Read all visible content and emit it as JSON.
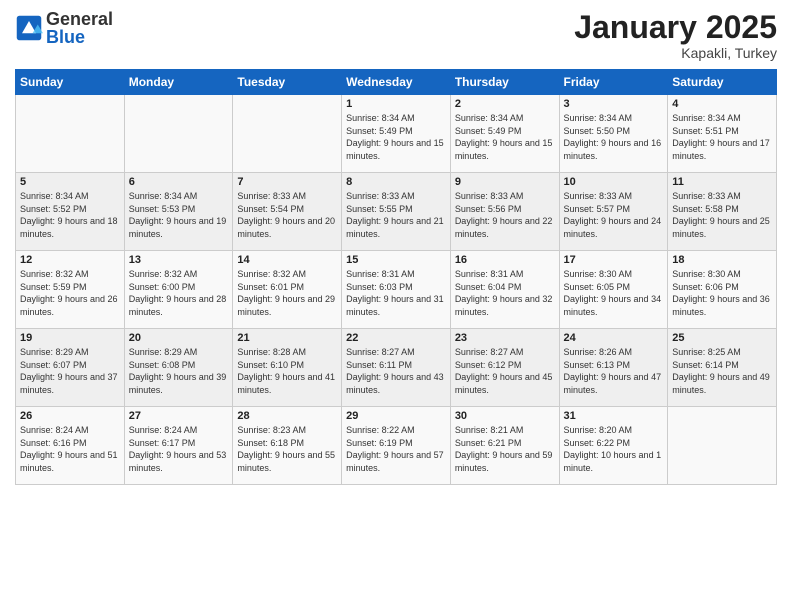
{
  "logo": {
    "general": "General",
    "blue": "Blue"
  },
  "title": "January 2025",
  "location": "Kapakli, Turkey",
  "headers": [
    "Sunday",
    "Monday",
    "Tuesday",
    "Wednesday",
    "Thursday",
    "Friday",
    "Saturday"
  ],
  "weeks": [
    [
      {
        "day": "",
        "sunrise": "",
        "sunset": "",
        "daylight": ""
      },
      {
        "day": "",
        "sunrise": "",
        "sunset": "",
        "daylight": ""
      },
      {
        "day": "",
        "sunrise": "",
        "sunset": "",
        "daylight": ""
      },
      {
        "day": "1",
        "sunrise": "Sunrise: 8:34 AM",
        "sunset": "Sunset: 5:49 PM",
        "daylight": "Daylight: 9 hours and 15 minutes."
      },
      {
        "day": "2",
        "sunrise": "Sunrise: 8:34 AM",
        "sunset": "Sunset: 5:49 PM",
        "daylight": "Daylight: 9 hours and 15 minutes."
      },
      {
        "day": "3",
        "sunrise": "Sunrise: 8:34 AM",
        "sunset": "Sunset: 5:50 PM",
        "daylight": "Daylight: 9 hours and 16 minutes."
      },
      {
        "day": "4",
        "sunrise": "Sunrise: 8:34 AM",
        "sunset": "Sunset: 5:51 PM",
        "daylight": "Daylight: 9 hours and 17 minutes."
      }
    ],
    [
      {
        "day": "5",
        "sunrise": "Sunrise: 8:34 AM",
        "sunset": "Sunset: 5:52 PM",
        "daylight": "Daylight: 9 hours and 18 minutes."
      },
      {
        "day": "6",
        "sunrise": "Sunrise: 8:34 AM",
        "sunset": "Sunset: 5:53 PM",
        "daylight": "Daylight: 9 hours and 19 minutes."
      },
      {
        "day": "7",
        "sunrise": "Sunrise: 8:33 AM",
        "sunset": "Sunset: 5:54 PM",
        "daylight": "Daylight: 9 hours and 20 minutes."
      },
      {
        "day": "8",
        "sunrise": "Sunrise: 8:33 AM",
        "sunset": "Sunset: 5:55 PM",
        "daylight": "Daylight: 9 hours and 21 minutes."
      },
      {
        "day": "9",
        "sunrise": "Sunrise: 8:33 AM",
        "sunset": "Sunset: 5:56 PM",
        "daylight": "Daylight: 9 hours and 22 minutes."
      },
      {
        "day": "10",
        "sunrise": "Sunrise: 8:33 AM",
        "sunset": "Sunset: 5:57 PM",
        "daylight": "Daylight: 9 hours and 24 minutes."
      },
      {
        "day": "11",
        "sunrise": "Sunrise: 8:33 AM",
        "sunset": "Sunset: 5:58 PM",
        "daylight": "Daylight: 9 hours and 25 minutes."
      }
    ],
    [
      {
        "day": "12",
        "sunrise": "Sunrise: 8:32 AM",
        "sunset": "Sunset: 5:59 PM",
        "daylight": "Daylight: 9 hours and 26 minutes."
      },
      {
        "day": "13",
        "sunrise": "Sunrise: 8:32 AM",
        "sunset": "Sunset: 6:00 PM",
        "daylight": "Daylight: 9 hours and 28 minutes."
      },
      {
        "day": "14",
        "sunrise": "Sunrise: 8:32 AM",
        "sunset": "Sunset: 6:01 PM",
        "daylight": "Daylight: 9 hours and 29 minutes."
      },
      {
        "day": "15",
        "sunrise": "Sunrise: 8:31 AM",
        "sunset": "Sunset: 6:03 PM",
        "daylight": "Daylight: 9 hours and 31 minutes."
      },
      {
        "day": "16",
        "sunrise": "Sunrise: 8:31 AM",
        "sunset": "Sunset: 6:04 PM",
        "daylight": "Daylight: 9 hours and 32 minutes."
      },
      {
        "day": "17",
        "sunrise": "Sunrise: 8:30 AM",
        "sunset": "Sunset: 6:05 PM",
        "daylight": "Daylight: 9 hours and 34 minutes."
      },
      {
        "day": "18",
        "sunrise": "Sunrise: 8:30 AM",
        "sunset": "Sunset: 6:06 PM",
        "daylight": "Daylight: 9 hours and 36 minutes."
      }
    ],
    [
      {
        "day": "19",
        "sunrise": "Sunrise: 8:29 AM",
        "sunset": "Sunset: 6:07 PM",
        "daylight": "Daylight: 9 hours and 37 minutes."
      },
      {
        "day": "20",
        "sunrise": "Sunrise: 8:29 AM",
        "sunset": "Sunset: 6:08 PM",
        "daylight": "Daylight: 9 hours and 39 minutes."
      },
      {
        "day": "21",
        "sunrise": "Sunrise: 8:28 AM",
        "sunset": "Sunset: 6:10 PM",
        "daylight": "Daylight: 9 hours and 41 minutes."
      },
      {
        "day": "22",
        "sunrise": "Sunrise: 8:27 AM",
        "sunset": "Sunset: 6:11 PM",
        "daylight": "Daylight: 9 hours and 43 minutes."
      },
      {
        "day": "23",
        "sunrise": "Sunrise: 8:27 AM",
        "sunset": "Sunset: 6:12 PM",
        "daylight": "Daylight: 9 hours and 45 minutes."
      },
      {
        "day": "24",
        "sunrise": "Sunrise: 8:26 AM",
        "sunset": "Sunset: 6:13 PM",
        "daylight": "Daylight: 9 hours and 47 minutes."
      },
      {
        "day": "25",
        "sunrise": "Sunrise: 8:25 AM",
        "sunset": "Sunset: 6:14 PM",
        "daylight": "Daylight: 9 hours and 49 minutes."
      }
    ],
    [
      {
        "day": "26",
        "sunrise": "Sunrise: 8:24 AM",
        "sunset": "Sunset: 6:16 PM",
        "daylight": "Daylight: 9 hours and 51 minutes."
      },
      {
        "day": "27",
        "sunrise": "Sunrise: 8:24 AM",
        "sunset": "Sunset: 6:17 PM",
        "daylight": "Daylight: 9 hours and 53 minutes."
      },
      {
        "day": "28",
        "sunrise": "Sunrise: 8:23 AM",
        "sunset": "Sunset: 6:18 PM",
        "daylight": "Daylight: 9 hours and 55 minutes."
      },
      {
        "day": "29",
        "sunrise": "Sunrise: 8:22 AM",
        "sunset": "Sunset: 6:19 PM",
        "daylight": "Daylight: 9 hours and 57 minutes."
      },
      {
        "day": "30",
        "sunrise": "Sunrise: 8:21 AM",
        "sunset": "Sunset: 6:21 PM",
        "daylight": "Daylight: 9 hours and 59 minutes."
      },
      {
        "day": "31",
        "sunrise": "Sunrise: 8:20 AM",
        "sunset": "Sunset: 6:22 PM",
        "daylight": "Daylight: 10 hours and 1 minute."
      },
      {
        "day": "",
        "sunrise": "",
        "sunset": "",
        "daylight": ""
      }
    ]
  ]
}
